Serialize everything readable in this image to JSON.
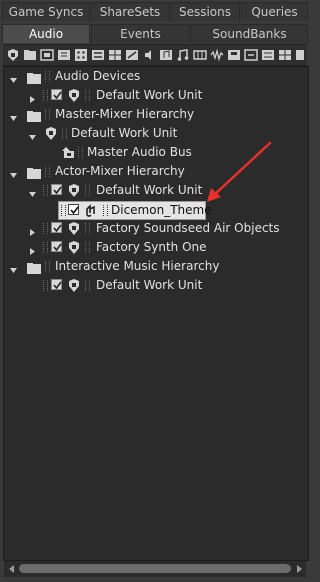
{
  "tabs_row1": [
    {
      "label": "Game Syncs"
    },
    {
      "label": "ShareSets"
    },
    {
      "label": "Sessions"
    },
    {
      "label": "Queries"
    }
  ],
  "tabs_row2": [
    {
      "label": "Audio",
      "active": true
    },
    {
      "label": "Events"
    },
    {
      "label": "SoundBanks"
    }
  ],
  "tree": {
    "audio_devices": {
      "label": "Audio Devices"
    },
    "audio_devices_wu": {
      "label": "Default Work Unit"
    },
    "master_mixer": {
      "label": "Master-Mixer Hierarchy"
    },
    "master_mixer_wu": {
      "label": "Default Work Unit"
    },
    "master_audio_bus": {
      "label": "Master Audio Bus"
    },
    "actor_mixer": {
      "label": "Actor-Mixer Hierarchy"
    },
    "actor_mixer_wu": {
      "label": "Default Work Unit"
    },
    "dicemon_theme": {
      "label": "Dicemon_Theme"
    },
    "factory_soundseed": {
      "label": "Factory Soundseed Air Objects"
    },
    "factory_synth": {
      "label": "Factory Synth One"
    },
    "interactive_music": {
      "label": "Interactive Music Hierarchy"
    },
    "interactive_music_wu": {
      "label": "Default Work Unit"
    }
  },
  "colors": {
    "background": "#3a3a3a",
    "tree_background": "#2b2b2b",
    "selection": "#e4e4e4",
    "annotation_arrow": "#e8302a"
  }
}
